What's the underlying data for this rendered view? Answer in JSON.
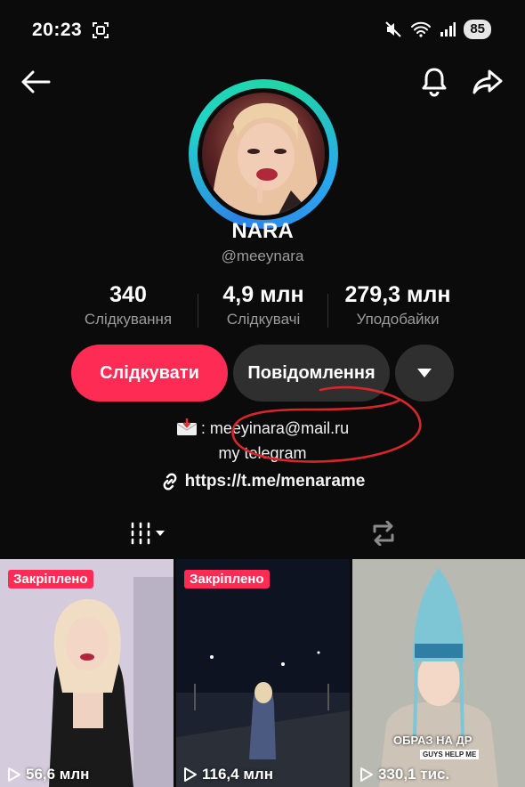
{
  "status_bar": {
    "time": "20:23",
    "battery": "85",
    "icons": [
      "screen-record-icon",
      "mute-icon",
      "wifi-icon",
      "signal-icon"
    ]
  },
  "nav": {
    "icons": [
      "back-arrow-icon",
      "bell-icon",
      "share-icon"
    ]
  },
  "profile": {
    "display_name": "NARA",
    "username": "@meeynara"
  },
  "stats": {
    "following": {
      "value": "340",
      "label": "Слідкування"
    },
    "followers": {
      "value": "4,9 млн",
      "label": "Слідкувачі"
    },
    "likes": {
      "value": "279,3 млн",
      "label": "Уподобайки"
    }
  },
  "buttons": {
    "follow": "Слідкувати",
    "message": "Повідомлення"
  },
  "bio": {
    "email_line": ": meeyinara@mail.ru",
    "telegram_line": "my telegram",
    "link": "https://t.me/menarame"
  },
  "tabs": {
    "icons": [
      "videos-grid-icon",
      "reposts-icon"
    ]
  },
  "videos": [
    {
      "pinned_label": "Закріплено",
      "views": "56,6 млн"
    },
    {
      "pinned_label": "Закріплено",
      "views": "116,4 млн"
    },
    {
      "views": "330,1 тис.",
      "overlay_text": "ОБРАЗ НА ДР",
      "overlay_small": "GUYS HELP ME"
    }
  ],
  "colors": {
    "accent": "#fe2c55",
    "background": "#0b0b0b",
    "secondary_button": "#2f2f2f",
    "muted_text": "#9b9b9b",
    "annotation": "#d9262b"
  }
}
